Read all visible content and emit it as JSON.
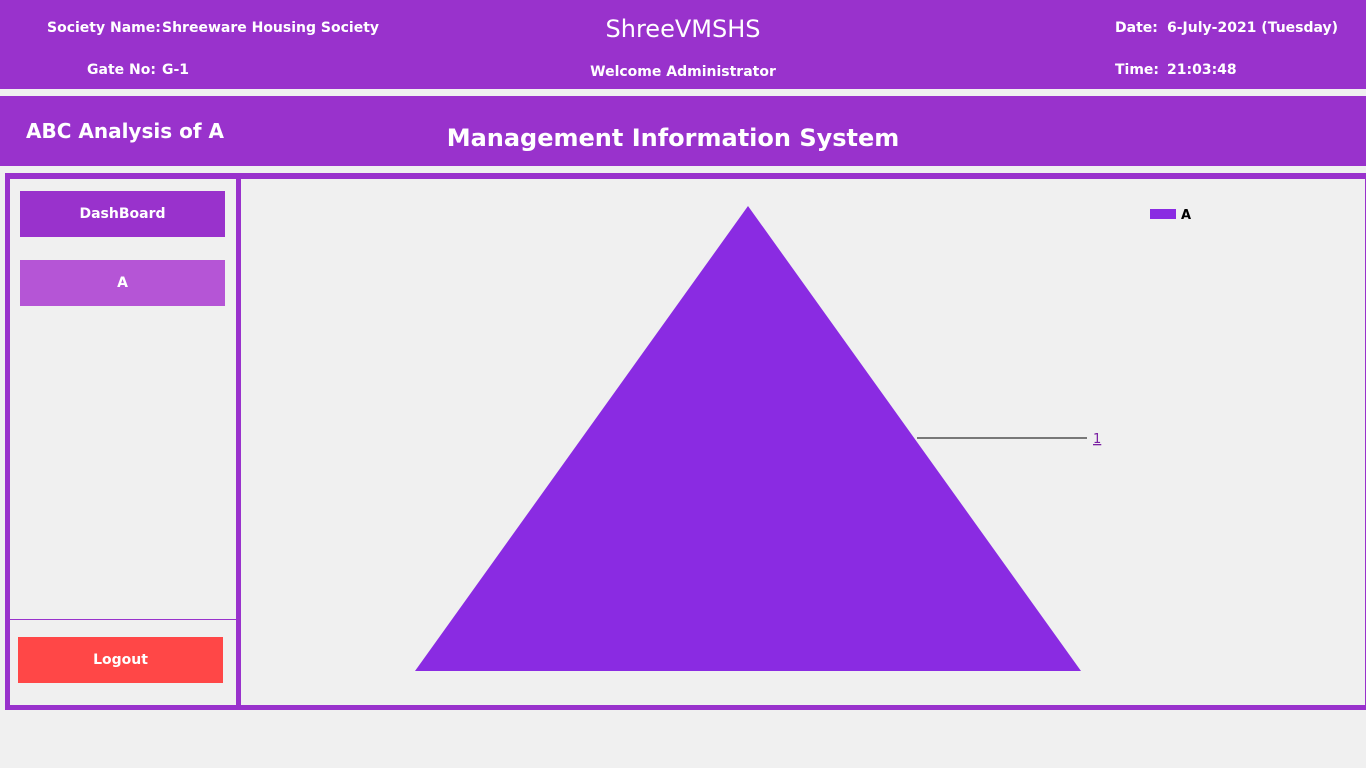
{
  "header": {
    "society_label": "Society Name:",
    "society_value": "Shreeware Housing Society",
    "gate_label": "Gate No:",
    "gate_value": "G-1",
    "app_title": "ShreeVMSHS",
    "welcome": "Welcome Administrator",
    "date_label": "Date:",
    "date_value": "6-July-2021 (Tuesday)",
    "time_label": "Time:",
    "time_value": "21:03:48"
  },
  "title_bar": {
    "page_title": "ABC Analysis of A",
    "section_title": "Management Information System"
  },
  "sidebar": {
    "items": [
      {
        "label": "DashBoard",
        "color": "#9932cc"
      },
      {
        "label": "A",
        "color": "#b555d6"
      }
    ],
    "logout_label": "Logout",
    "logout_color": "#ff4747"
  },
  "colors": {
    "accent": "#9932cc",
    "series_fill": "#8a2be2"
  },
  "chart_data": {
    "type": "pyramid",
    "categories": [
      "A"
    ],
    "values": [
      1
    ],
    "data_labels": [
      "1"
    ],
    "legend": [
      "A"
    ],
    "legend_position": "top-right"
  }
}
